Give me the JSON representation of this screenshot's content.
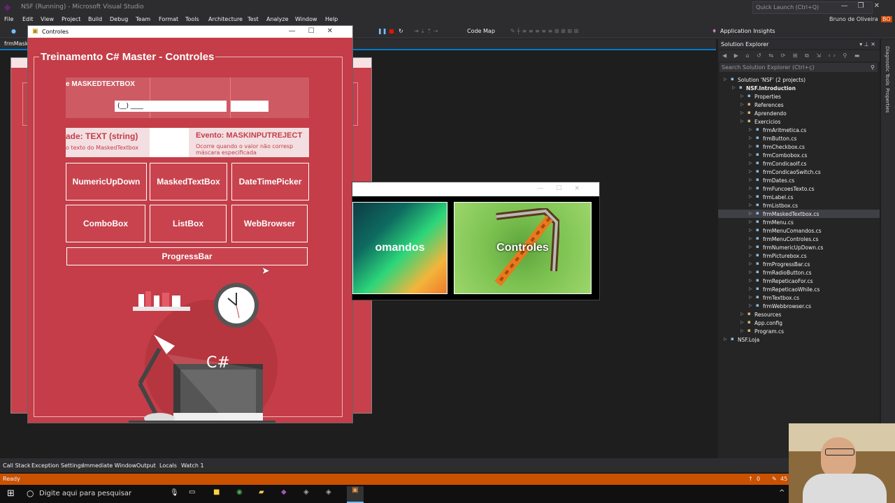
{
  "vs": {
    "title": "NSF (Running) - Microsoft Visual Studio",
    "quick_launch_placeholder": "Quick Launch (Ctrl+Q)",
    "user": "Bruno de Oliveira",
    "user_initials": "BO",
    "menu": [
      "File",
      "Edit",
      "View",
      "Project",
      "Build",
      "Debug",
      "Team",
      "Format",
      "Tools",
      "Architecture",
      "Test",
      "Analyze",
      "Window",
      "Help"
    ],
    "toolbar": {
      "code_map": "Code Map",
      "app_insights": "Application Insights"
    },
    "editor_tab": "frmMask",
    "bottom_tabs": [
      "Call Stack",
      "Exception Settings",
      "Immediate Window",
      "Output",
      "Locals",
      "Watch 1"
    ],
    "status": "Ready",
    "status_right": [
      "0",
      "45"
    ]
  },
  "solution_explorer": {
    "title": "Solution Explorer",
    "search_placeholder": "Search Solution Explorer (Ctrl+ç)",
    "items": [
      {
        "label": "Solution 'NSF' (2 projects)",
        "level": 0
      },
      {
        "label": "NSF.Introduction",
        "level": 1,
        "bold": true
      },
      {
        "label": "Properties",
        "level": 2
      },
      {
        "label": "References",
        "level": 2
      },
      {
        "label": "Aprendendo",
        "level": 2
      },
      {
        "label": "Exercicios",
        "level": 2
      },
      {
        "label": "frmAritmetica.cs",
        "level": 3
      },
      {
        "label": "frmButton.cs",
        "level": 3
      },
      {
        "label": "frmCheckbox.cs",
        "level": 3
      },
      {
        "label": "frmCombobox.cs",
        "level": 3
      },
      {
        "label": "frmCondicaoIf.cs",
        "level": 3
      },
      {
        "label": "frmCondicaoSwitch.cs",
        "level": 3
      },
      {
        "label": "frmDates.cs",
        "level": 3
      },
      {
        "label": "frmFuncoesTexto.cs",
        "level": 3
      },
      {
        "label": "frmLabel.cs",
        "level": 3
      },
      {
        "label": "frmListbox.cs",
        "level": 3
      },
      {
        "label": "frmMaskedTextbox.cs",
        "level": 3,
        "selected": true
      },
      {
        "label": "frmMenu.cs",
        "level": 3
      },
      {
        "label": "frmMenuComandos.cs",
        "level": 3
      },
      {
        "label": "frmMenuControles.cs",
        "level": 3
      },
      {
        "label": "frmNumericUpDown.cs",
        "level": 3
      },
      {
        "label": "frmPicturebox.cs",
        "level": 3
      },
      {
        "label": "frmProgressBar.cs",
        "level": 3
      },
      {
        "label": "frmRadioButton.cs",
        "level": 3
      },
      {
        "label": "frmRepeticaoFor.cs",
        "level": 3
      },
      {
        "label": "frmRepeticaoWhile.cs",
        "level": 3
      },
      {
        "label": "frmTextbox.cs",
        "level": 3
      },
      {
        "label": "frmWebbrowser.cs",
        "level": 3
      },
      {
        "label": "Resources",
        "level": 2
      },
      {
        "label": "App.config",
        "level": 2
      },
      {
        "label": "Program.cs",
        "level": 2
      },
      {
        "label": "NSF.Loja",
        "level": 0
      }
    ]
  },
  "side_strip": [
    "Diagnostic Tools",
    "Properties"
  ],
  "controles_form": {
    "window_title": "Controles",
    "heading": "Treinamento C# Master - Controles",
    "masked_header": "e MASKEDTEXTBOX",
    "mask_value": "(__) ____",
    "prop_title": "ade: TEXT (string)",
    "prop_desc": "o texto do MaskedTextbox",
    "event_title": "Evento: MASKINPUTREJECT",
    "event_desc": "Ocorre quando o valor não corresp máscara especificada",
    "buttons": [
      "NumericUpDown",
      "MaskedTextBox",
      "DateTimePicker",
      "ComboBox",
      "ListBox",
      "WebBrowser",
      "ProgressBar"
    ],
    "illustration_label": "C#"
  },
  "menu_form": {
    "card_left": "omandos",
    "card_right": "Controles"
  },
  "taskbar": {
    "search_placeholder": "Digite aqui para pesquisar"
  }
}
